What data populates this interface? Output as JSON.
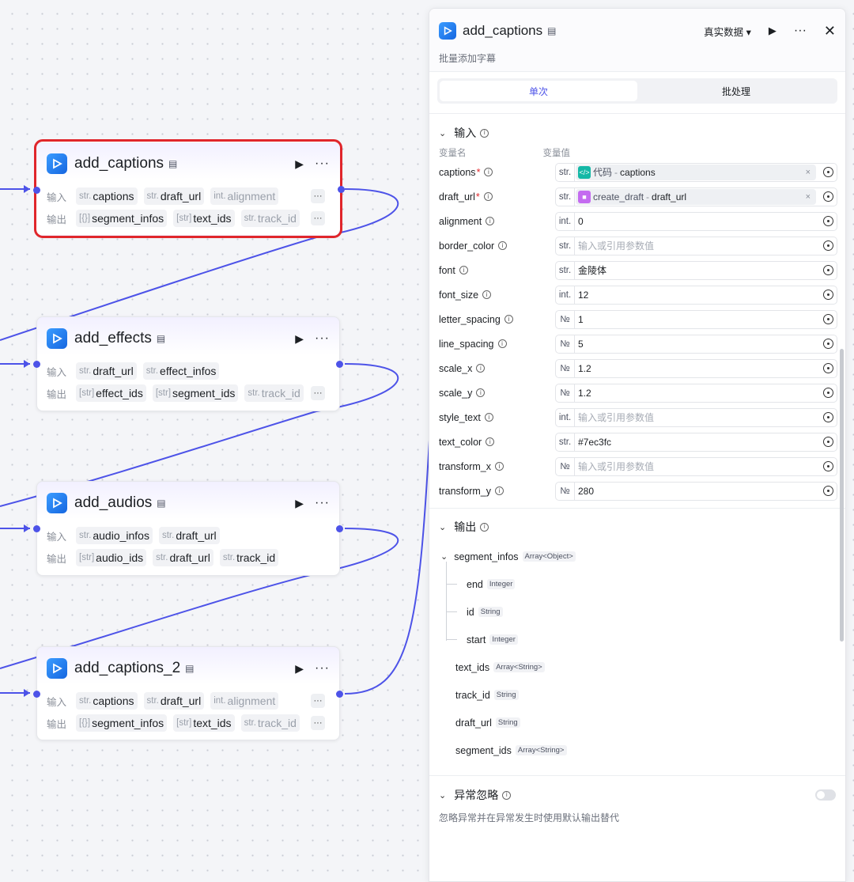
{
  "nodes": [
    {
      "title": "add_captions",
      "inputs": [
        {
          "type": "str.",
          "name": "captions"
        },
        {
          "type": "str.",
          "name": "draft_url"
        },
        {
          "type": "int.",
          "name": "alignment"
        }
      ],
      "outputs": [
        {
          "type": "[{}]",
          "name": "segment_infos"
        },
        {
          "type": "[str]",
          "name": "text_ids"
        },
        {
          "type": "str.",
          "name": "track_id"
        }
      ]
    },
    {
      "title": "add_effects",
      "inputs": [
        {
          "type": "str.",
          "name": "draft_url"
        },
        {
          "type": "str.",
          "name": "effect_infos"
        }
      ],
      "outputs": [
        {
          "type": "[str]",
          "name": "effect_ids"
        },
        {
          "type": "[str]",
          "name": "segment_ids"
        },
        {
          "type": "str.",
          "name": "track_id"
        }
      ]
    },
    {
      "title": "add_audios",
      "inputs": [
        {
          "type": "str.",
          "name": "audio_infos"
        },
        {
          "type": "str.",
          "name": "draft_url"
        }
      ],
      "outputs": [
        {
          "type": "[str]",
          "name": "audio_ids"
        },
        {
          "type": "str.",
          "name": "draft_url"
        },
        {
          "type": "str.",
          "name": "track_id"
        }
      ]
    },
    {
      "title": "add_captions_2",
      "inputs": [
        {
          "type": "str.",
          "name": "captions"
        },
        {
          "type": "str.",
          "name": "draft_url"
        },
        {
          "type": "int.",
          "name": "alignment"
        }
      ],
      "outputs": [
        {
          "type": "[{}]",
          "name": "segment_infos"
        },
        {
          "type": "[str]",
          "name": "text_ids"
        },
        {
          "type": "str.",
          "name": "track_id"
        }
      ]
    }
  ],
  "node_labels": {
    "input": "输入",
    "output": "输出",
    "more": "···"
  },
  "panel": {
    "title": "add_captions",
    "description": "批量添加字幕",
    "data_select": "真实数据 ▾",
    "tabs": {
      "single": "单次",
      "batch": "批处理"
    },
    "input_section": "输入",
    "col_name": "变量名",
    "col_value": "变量值",
    "params": [
      {
        "name": "captions",
        "required": true,
        "type": "str.",
        "ref": {
          "node": "代码",
          "field": "captions",
          "color": "#14b8a6"
        }
      },
      {
        "name": "draft_url",
        "required": true,
        "type": "str.",
        "ref": {
          "node": "create_draft",
          "field": "draft_url",
          "color": "#c46bf0"
        }
      },
      {
        "name": "alignment",
        "type": "int.",
        "value": "0"
      },
      {
        "name": "border_color",
        "type": "str.",
        "placeholder": "输入或引用参数值"
      },
      {
        "name": "font",
        "type": "str.",
        "value": "金陵体"
      },
      {
        "name": "font_size",
        "type": "int.",
        "value": "12"
      },
      {
        "name": "letter_spacing",
        "type": "№",
        "value": "1"
      },
      {
        "name": "line_spacing",
        "type": "№",
        "value": "5"
      },
      {
        "name": "scale_x",
        "type": "№",
        "value": "1.2"
      },
      {
        "name": "scale_y",
        "type": "№",
        "value": "1.2"
      },
      {
        "name": "style_text",
        "type": "int.",
        "placeholder": "输入或引用参数值"
      },
      {
        "name": "text_color",
        "type": "str.",
        "value": "#7ec3fc"
      },
      {
        "name": "transform_x",
        "type": "№",
        "placeholder": "输入或引用参数值"
      },
      {
        "name": "transform_y",
        "type": "№",
        "value": "280"
      }
    ],
    "output_section": "输出",
    "outputs": {
      "segment_infos": {
        "name": "segment_infos",
        "type": "Array<Object>"
      },
      "children": [
        {
          "name": "end",
          "type": "Integer"
        },
        {
          "name": "id",
          "type": "String"
        },
        {
          "name": "start",
          "type": "Integer"
        }
      ],
      "rest": [
        {
          "name": "text_ids",
          "type": "Array<String>"
        },
        {
          "name": "track_id",
          "type": "String"
        },
        {
          "name": "draft_url",
          "type": "String"
        },
        {
          "name": "segment_ids",
          "type": "Array<String>"
        }
      ]
    },
    "error_section": "异常忽略",
    "error_desc": "忽略异常并在异常发生时使用默认输出替代"
  },
  "colors": {
    "accent": "#4d53e8",
    "edge": "#4d53e8",
    "selected": "#e0262b"
  }
}
